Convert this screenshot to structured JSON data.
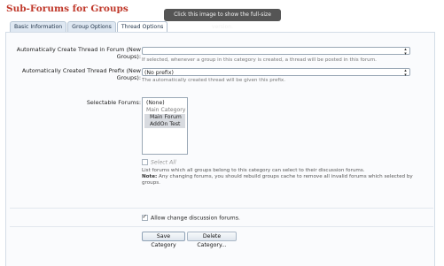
{
  "page_title": "Sub-Forums for Groups",
  "tooltip": "Click this image to show the full-size version.",
  "tabs": [
    {
      "label": "Basic Information",
      "active": false
    },
    {
      "label": "Group Options",
      "active": false
    },
    {
      "label": "Thread Options",
      "active": true
    }
  ],
  "fields": {
    "auto_thread": {
      "label_line1": "Automatically Create Thread in Forum (New",
      "label_line2": "Groups):",
      "value": "",
      "hint": "If selected, whenever a group in this category is created, a thread will be posted in this forum."
    },
    "prefix": {
      "label_line1": "Automatically Created Thread Prefix (New",
      "label_line2": "Groups):",
      "value": "(No prefix)",
      "hint": "The automatically created thread will be given this prefix."
    },
    "selectable_forums": {
      "label": "Selectable Forums:",
      "options": [
        "(None)",
        "Main Category",
        "Main Forum",
        "AddOn Test"
      ],
      "select_all": "Select All",
      "desc_line1": "List forums which all groups belong to this category can select to their discussion forums.",
      "desc_note_label": "Note:",
      "desc_note": "Any changing forums, you should rebuild groups cache to remove all invalid forums which selected by",
      "desc_line3": "groups."
    },
    "allow_change": {
      "label": "Allow change discussion forums.",
      "checked": true
    }
  },
  "buttons": {
    "save": "Save Category",
    "delete": "Delete Category..."
  }
}
